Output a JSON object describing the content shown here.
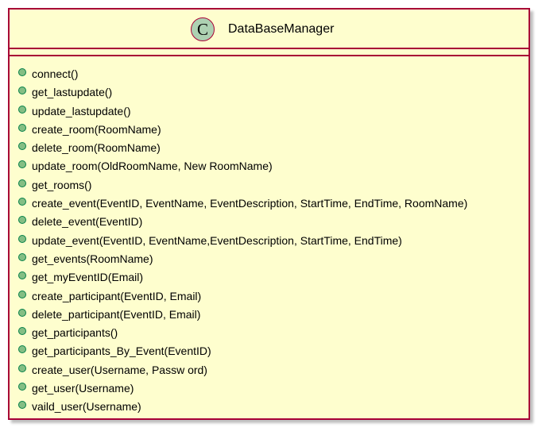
{
  "class": {
    "stereotype_letter": "C",
    "name": "DataBaseManager",
    "colors": {
      "fill": "#FEFECE",
      "border": "#A80036",
      "badge": "#ADD1B2",
      "method_dot": "#84BE84"
    },
    "methods": [
      "connect()",
      "get_lastupdate()",
      "update_lastupdate()",
      "create_room(RoomName)",
      "delete_room(RoomName)",
      "update_room(OldRoomName, New RoomName)",
      "get_rooms()",
      "create_event(EventID, EventName, EventDescription, StartTime, EndTime, RoomName)",
      "delete_event(EventID)",
      "update_event(EventID, EventName,EventDescription, StartTime, EndTime)",
      "get_events(RoomName)",
      "get_myEventID(Email)",
      "create_participant(EventID, Email)",
      "delete_participant(EventID, Email)",
      "get_participants()",
      "get_participants_By_Event(EventID)",
      "create_user(Username, Passw ord)",
      "get_user(Username)",
      "vaild_user(Username)"
    ]
  }
}
